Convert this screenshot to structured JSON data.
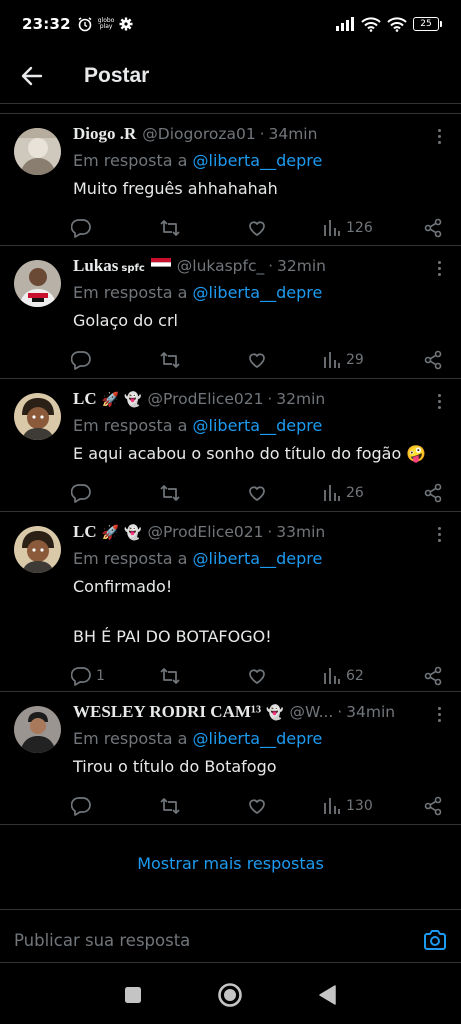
{
  "status_bar": {
    "time": "23:32",
    "app_badge_line1": "globo",
    "app_badge_line2": "play",
    "battery": "25"
  },
  "header": {
    "title": "Postar"
  },
  "replies": [
    {
      "name": "Diogo .R",
      "name_extra": "",
      "handle": "@Diogoroza01",
      "time": "34min",
      "reply_prefix": "Em resposta a",
      "reply_to": "@liberta__depre",
      "text": "Muito freguês ahhahahah",
      "reply_count": "",
      "views": "126"
    },
    {
      "name": "Lukas",
      "name_extra": "spfc",
      "handle": "@lukaspfc_",
      "time": "32min",
      "reply_prefix": "Em resposta a",
      "reply_to": "@liberta__depre",
      "text": "Golaço do crl",
      "reply_count": "",
      "views": "29"
    },
    {
      "name": "LC",
      "name_extra": "",
      "handle": "@ProdElice021",
      "time": "32min",
      "reply_prefix": "Em resposta a",
      "reply_to": "@liberta__depre",
      "text": "E aqui acabou o sonho do título do fogão 🤪",
      "reply_count": "",
      "views": "26"
    },
    {
      "name": "LC",
      "name_extra": "",
      "handle": "@ProdElice021",
      "time": "33min",
      "reply_prefix": "Em resposta a",
      "reply_to": "@liberta__depre",
      "text": "Confirmado!\n\nBH É PAI DO BOTAFOGO!",
      "reply_count": "1",
      "views": "62"
    },
    {
      "name": "WESLEY RODRI CAM¹³",
      "name_extra": "",
      "handle": "@W...",
      "time": "34min",
      "reply_prefix": "Em resposta a",
      "reply_to": "@liberta__depre",
      "text": "Tirou o título do Botafogo",
      "reply_count": "",
      "views": "130"
    }
  ],
  "show_more": "Mostrar mais respostas",
  "compose": {
    "placeholder": "Publicar sua resposta"
  },
  "colors": {
    "accent": "#1d9bf0",
    "muted": "#71767b",
    "background": "#000000"
  }
}
